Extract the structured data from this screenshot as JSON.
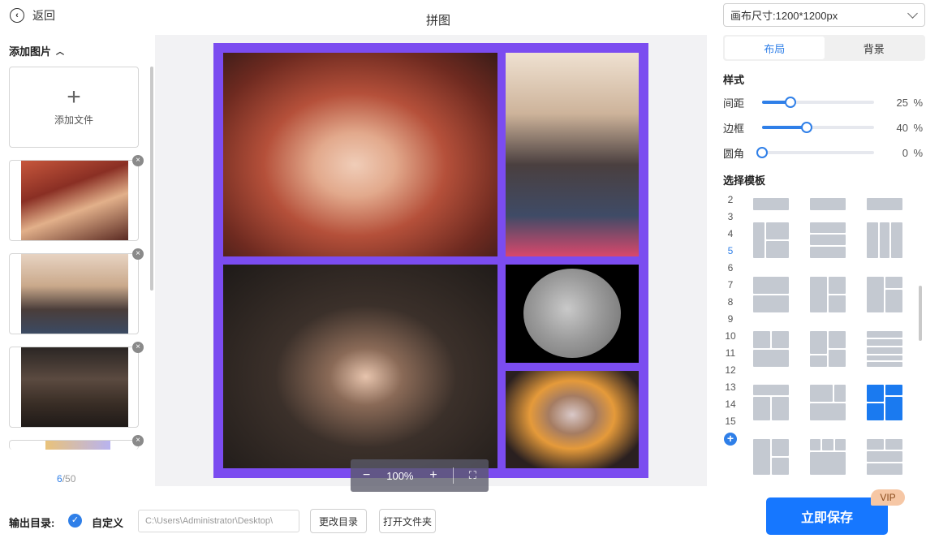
{
  "header": {
    "back_label": "返回",
    "title": "拼图"
  },
  "left_panel": {
    "section_title": "添加图片",
    "add_file_label": "添加文件",
    "delete_symbol": "×",
    "count_current": "6",
    "count_total": "/50"
  },
  "canvas": {
    "zoom": "100%",
    "frame_color": "#7b4cf0"
  },
  "right_panel": {
    "canvas_size": "画布尺寸:1200*1200px",
    "tabs": [
      "布局",
      "背景"
    ],
    "style_title": "样式",
    "sliders": [
      {
        "label": "间距",
        "value": "25",
        "unit": "%",
        "level": 0.25
      },
      {
        "label": "边框",
        "value": "40",
        "unit": "%",
        "level": 0.4
      },
      {
        "label": "圆角",
        "value": "0",
        "unit": "%",
        "level": 0.0
      }
    ],
    "template_title": "选择模板",
    "template_counts": [
      "2",
      "3",
      "4",
      "5",
      "6",
      "7",
      "8",
      "9",
      "10",
      "11",
      "12",
      "13",
      "14",
      "15"
    ],
    "selected_count": "5",
    "add_symbol": "+",
    "accent_color": "#2f7fe8"
  },
  "bottom": {
    "output_label": "输出目录:",
    "checkbox_symbol": "✓",
    "custom_label": "自定义",
    "path_value": "C:\\Users\\Administrator\\Desktop\\",
    "change_dir": "更改目录",
    "open_folder": "打开文件夹",
    "save_button": "立即保存",
    "vip_badge": "VIP"
  }
}
